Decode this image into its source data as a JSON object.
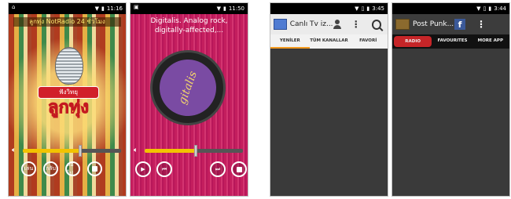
{
  "screens": [
    {
      "status_time": "11:16",
      "title": "ลูกทุ่ง NotRadio 24 ชั่วโมง",
      "logo_top": "ฟังวิทยุ",
      "logo_main": "ลูกทุ่ง",
      "volume_level": 0.58,
      "buttons": [
        "เล่น",
        "กลับ",
        "ต่อไป"
      ],
      "colors": {
        "accent": "#f2c300"
      }
    },
    {
      "status_time": "11:50",
      "now_playing": "Digitalis. Analog rock, digitally-affected,...",
      "art_text": "gitalis",
      "volume_level": 0.52,
      "colors": {
        "background": "#c41e5e",
        "accent": "#f2c300"
      }
    },
    {
      "status_time": "3:45",
      "title": "Canlı Tv iz...",
      "tabs": [
        "YENİLER",
        "TÜM KANALLAR",
        "FAVORİ"
      ],
      "colors": {
        "tab_indicator": "#f39a1f",
        "content_bg": "#3a3a3a"
      }
    },
    {
      "status_time": "3:44",
      "title": "Post Punk...",
      "tabs": [
        "RADIO",
        "FAVOURITES",
        "MORE APP"
      ],
      "colors": {
        "active_tab": "#c62528",
        "content_bg": "#3a3a3a"
      }
    }
  ]
}
